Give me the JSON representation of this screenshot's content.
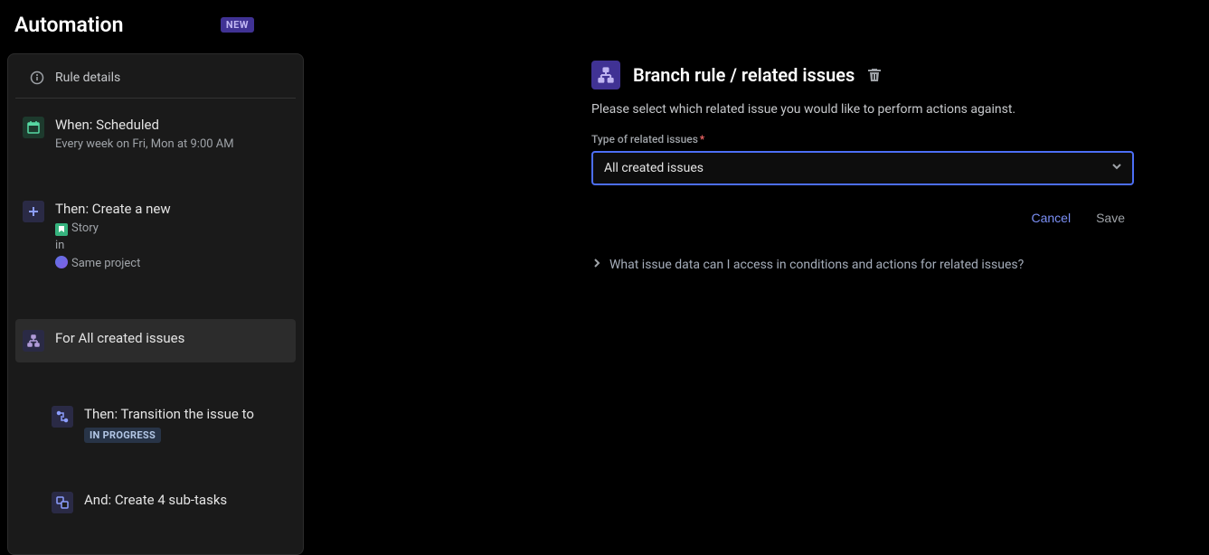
{
  "header": {
    "title": "Automation",
    "badge": "NEW"
  },
  "sidebar": {
    "rule_details_label": "Rule details",
    "steps": {
      "when": {
        "title": "When: Scheduled",
        "subtitle": "Every week on Fri, Mon at 9:00 AM"
      },
      "then_create": {
        "title": "Then: Create a new",
        "story_label": "Story",
        "in_label": "in",
        "project_label": "Same project"
      },
      "for_branch": {
        "title": "For All created issues"
      },
      "then_transition": {
        "title": "Then: Transition the issue to",
        "status": "IN PROGRESS"
      },
      "and_subtasks": {
        "title": "And: Create 4 sub-tasks"
      }
    }
  },
  "panel": {
    "title": "Branch rule / related issues",
    "description": "Please select which related issue you would like to perform actions against.",
    "field_label": "Type of related issues",
    "select_value": "All created issues",
    "cancel_label": "Cancel",
    "save_label": "Save",
    "expandable_text": "What issue data can I access in conditions and actions for related issues?"
  }
}
